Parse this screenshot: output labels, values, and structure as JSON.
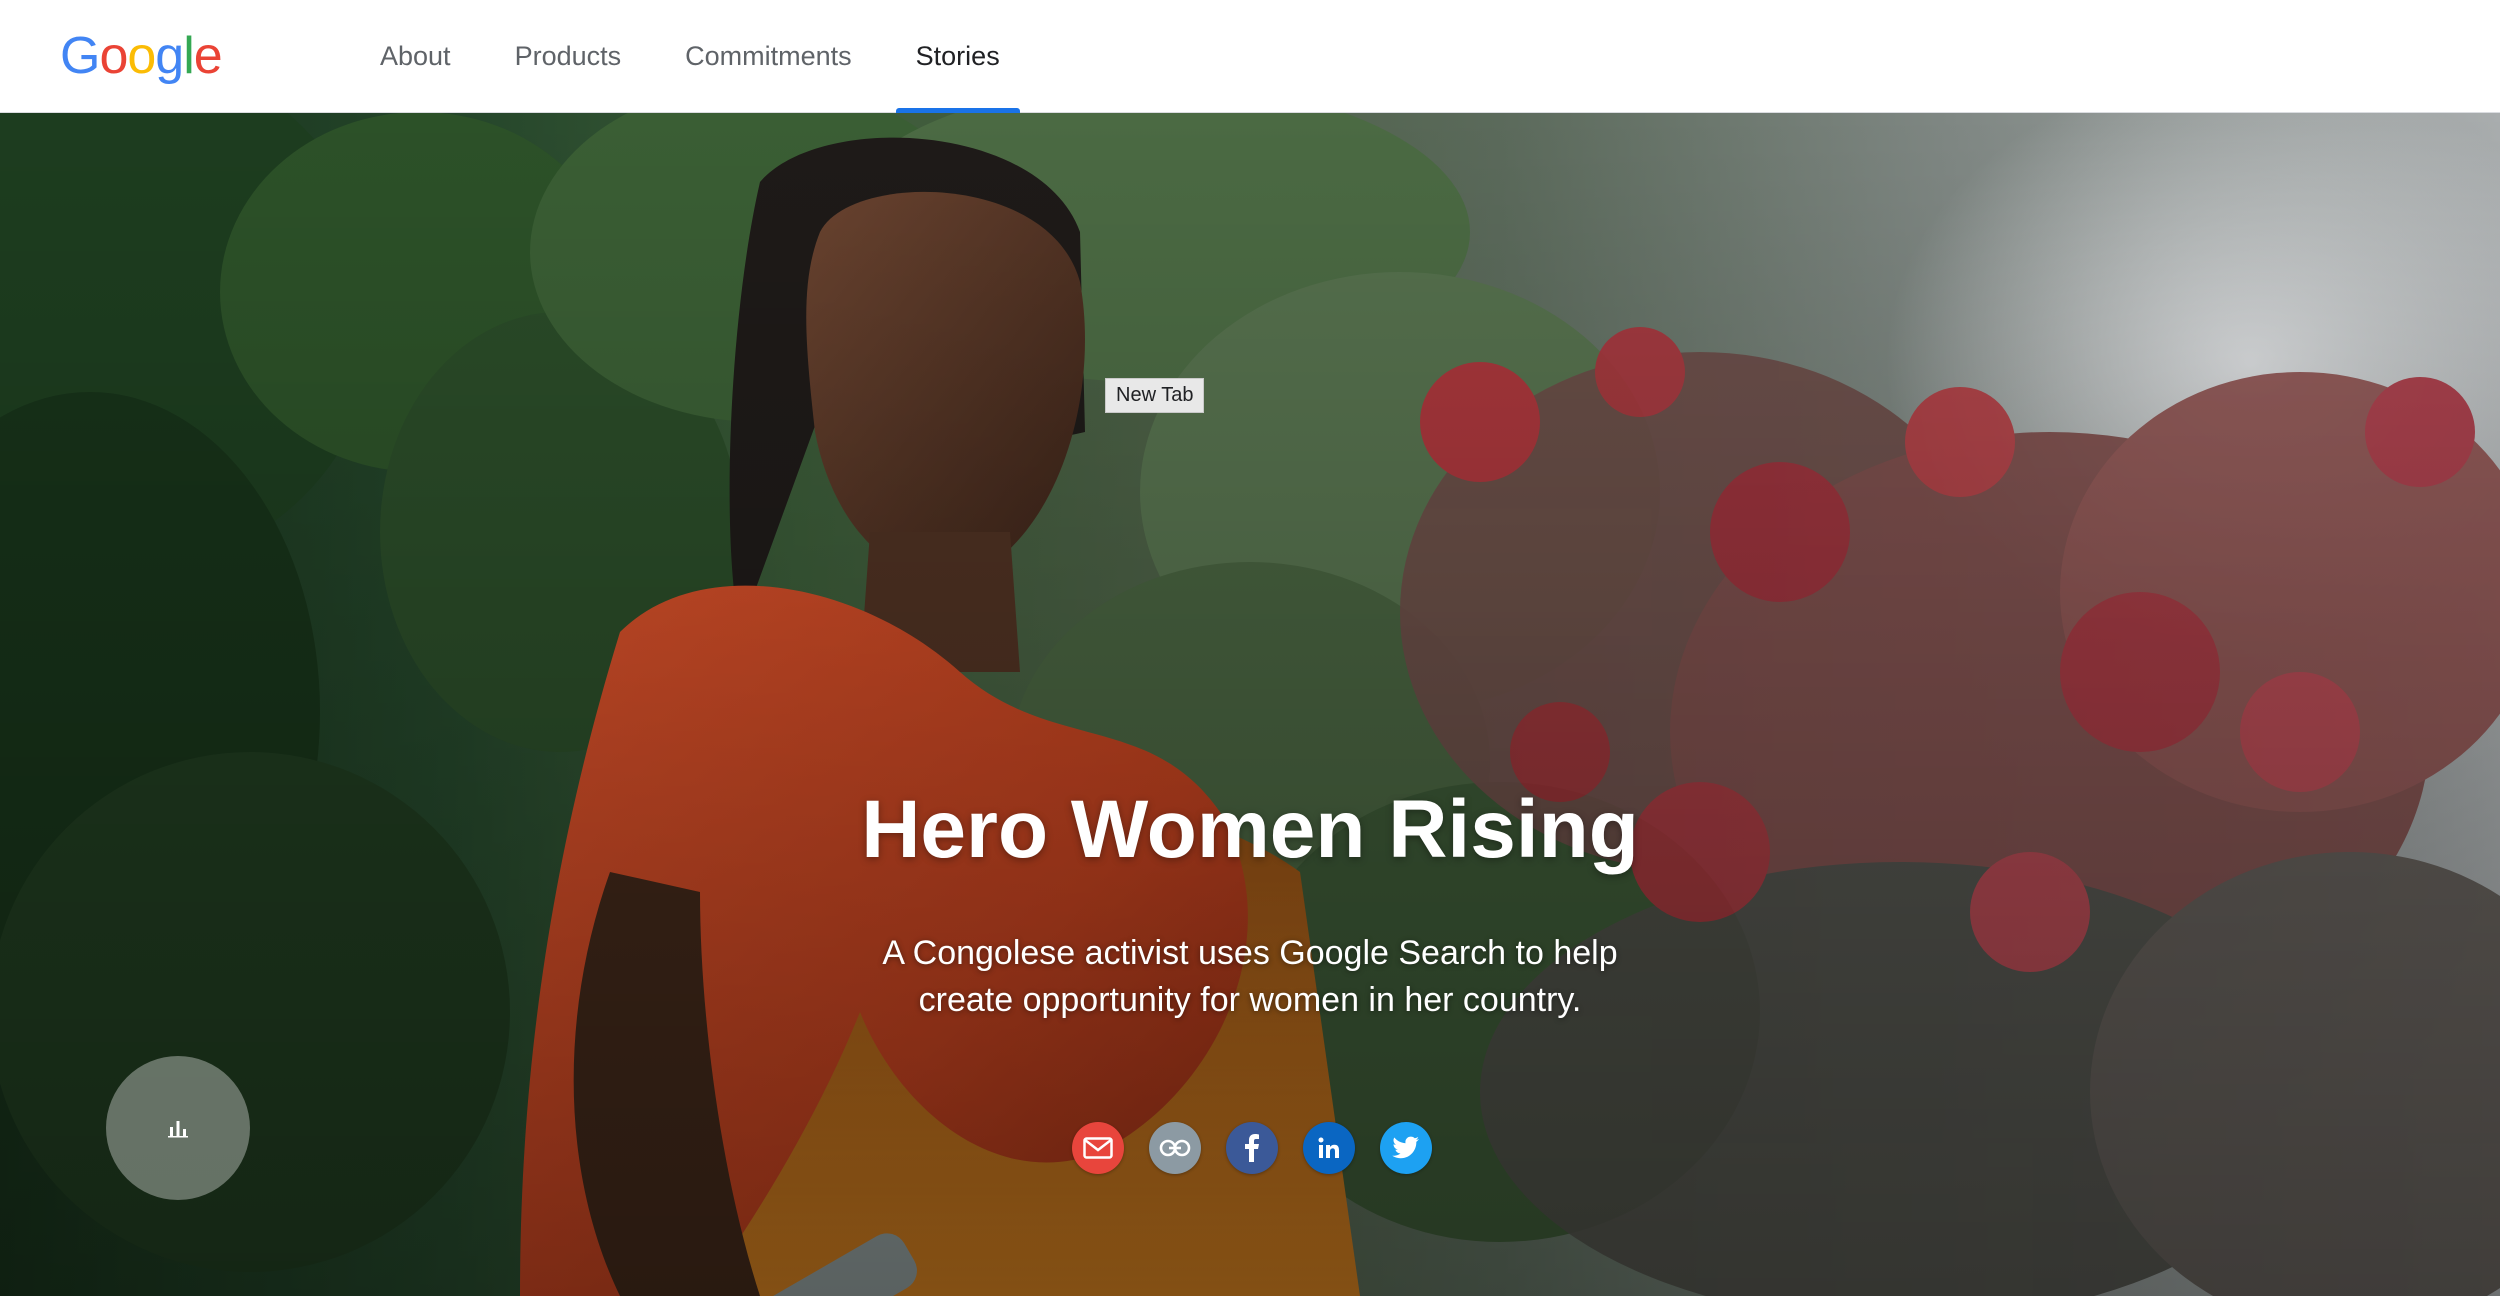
{
  "header": {
    "logo_letters": [
      "G",
      "o",
      "o",
      "g",
      "l",
      "e"
    ],
    "logo_colors": [
      "#4285F4",
      "#EA4335",
      "#FBBC05",
      "#4285F4",
      "#34A853",
      "#EA4335"
    ],
    "nav": [
      {
        "label": "About"
      },
      {
        "label": "Products"
      },
      {
        "label": "Commitments"
      },
      {
        "label": "Stories",
        "active": true
      }
    ],
    "active_indicator_color": "#1a73e8"
  },
  "hero": {
    "title": "Hero Women Rising",
    "subtitle": "A Congolese activist uses Google Search to help create opportunity for women in her country.",
    "tooltip": "New Tab"
  },
  "share": [
    {
      "name": "email",
      "icon": "mail-icon",
      "color": "#e8453c"
    },
    {
      "name": "copy-link",
      "icon": "link-icon",
      "color": "#8c9aa3"
    },
    {
      "name": "facebook",
      "icon": "facebook-icon",
      "color": "#3b5998"
    },
    {
      "name": "linkedin",
      "icon": "linkedin-icon",
      "color": "#0a66c2"
    },
    {
      "name": "twitter",
      "icon": "twitter-icon",
      "color": "#1da1f2"
    }
  ],
  "stats_button": {
    "icon": "bar-chart-icon"
  }
}
